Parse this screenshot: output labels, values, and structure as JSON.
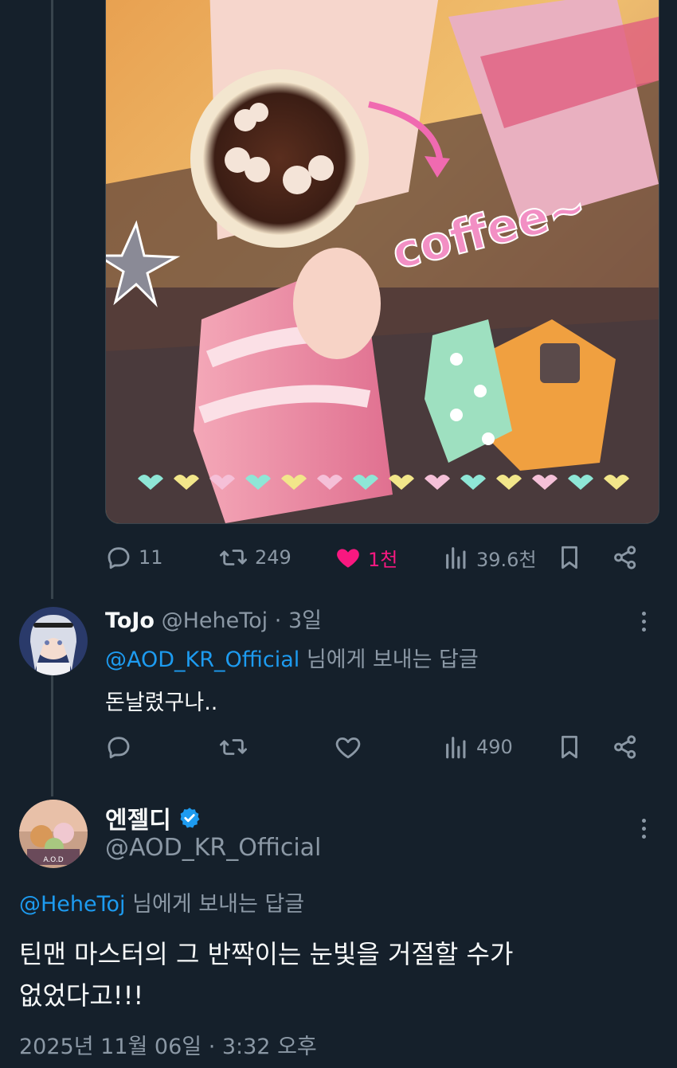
{
  "colors": {
    "background": "#15202b",
    "text_primary": "#f7f9f9",
    "text_secondary": "#8b98a5",
    "link": "#1d9bf0",
    "like_active": "#f91880",
    "verified_badge": "#1d9bf0"
  },
  "media": {
    "icon": "illustration-image",
    "overlay_text": "coffee~"
  },
  "main_post_actions": {
    "reply_count": "11",
    "repost_count": "249",
    "like_count": "1천",
    "liked": true,
    "views_count": "39.6천"
  },
  "reply": {
    "author_name": "ToJo",
    "handle": "@HeheToj",
    "separator": "·",
    "time": "3일",
    "reply_to_handle": "@AOD_KR_Official",
    "reply_to_suffix": " 님에게 보내는 답글",
    "text": "돈날렸구나..",
    "views_count": "490"
  },
  "focus_post": {
    "author_name": "엔젤디",
    "verified": true,
    "handle": "@AOD_KR_Official",
    "avatar_text": "A.O.D",
    "reply_to_handle": "@HeheToj",
    "reply_to_suffix": " 님에게 보내는 답글",
    "text_line1": "틴맨 마스터의 그 반짝이는 눈빛을 거절할 수가",
    "text_line2": "없었다고!!!",
    "timestamp": "2025년 11월 06일 · 3:32 오후"
  }
}
